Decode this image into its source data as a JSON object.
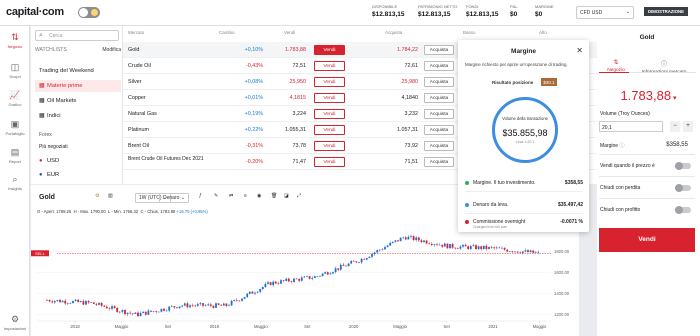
{
  "app": {
    "logo": "capital·com"
  },
  "topbar": {
    "stats": [
      {
        "label": "DISPONIBILE",
        "value": "$12.813,15"
      },
      {
        "label": "PATRIMONIO NETTO",
        "value": "$12.813,15"
      },
      {
        "label": "FONDI",
        "value": "$12.813,15"
      },
      {
        "label": "P&L",
        "value": "$0"
      },
      {
        "label": "MARGINE",
        "value": "$0"
      }
    ],
    "account_select": "CFD USD",
    "mode_badge": "DIMOSTRAZIONE"
  },
  "leftnav": {
    "items": [
      {
        "label": "Negozio",
        "icon": "trade-icon"
      },
      {
        "label": "Scopri",
        "icon": "discover-icon"
      },
      {
        "label": "Grafico",
        "icon": "chart-icon"
      },
      {
        "label": "Portafoglio",
        "icon": "portfolio-icon"
      },
      {
        "label": "Report",
        "icon": "report-icon"
      },
      {
        "label": "Insights",
        "icon": "insights-icon"
      },
      {
        "label": "Impostazioni",
        "icon": "settings-icon"
      }
    ]
  },
  "watchlist": {
    "search_placeholder": "Cerca",
    "tab_label": "WATCHLISTS",
    "edit_label": "Modifica",
    "lists": [
      "Trading del Weekend",
      "Materie prime",
      "Oil Markets",
      "Indici"
    ],
    "forex_label": "Forex",
    "most_traded_label": "Più negoziati",
    "currencies": [
      "USD",
      "EUR"
    ]
  },
  "table": {
    "headers": {
      "market": "Mercato",
      "change": "Cambio",
      "sell": "Vendi",
      "buy": "Acquista",
      "low": "Basso",
      "high": "Alto"
    },
    "sell_label": "Vendi",
    "buy_label": "Acquista",
    "rows": [
      {
        "name": "Gold",
        "change": "+0,10%",
        "sell": "1.783,88",
        "buy": "1.784,22",
        "dir": "pos",
        "sellRed": true,
        "buyRed": true
      },
      {
        "name": "Crude Oil",
        "change": "-0,43%",
        "sell": "72,51",
        "buy": "72,61",
        "dir": "neg",
        "sellRed": false,
        "buyRed": false
      },
      {
        "name": "Silver",
        "change": "+0,08%",
        "sell": "25,950",
        "buy": "25,980",
        "dir": "pos",
        "sellRed": true,
        "buyRed": true
      },
      {
        "name": "Copper",
        "change": "+0,01%",
        "sell": "4,1815",
        "buy": "4,1840",
        "dir": "pos",
        "sellRed": true,
        "buyRed": false
      },
      {
        "name": "Natural Gas",
        "change": "+0,19%",
        "sell": "3,224",
        "buy": "3,232",
        "dir": "pos",
        "sellRed": false,
        "buyRed": false
      },
      {
        "name": "Platinum",
        "change": "+0,22%",
        "sell": "1.055,31",
        "buy": "1.057,31",
        "dir": "pos",
        "sellRed": false,
        "buyRed": false
      },
      {
        "name": "Brent Oil",
        "change": "-0,31%",
        "sell": "73,78",
        "buy": "73,92",
        "dir": "neg",
        "sellRed": false,
        "buyRed": false
      },
      {
        "name": "Brent Crude Oil Futures Dec 2021",
        "change": "-0,20%",
        "sell": "71,47",
        "buy": "71,51",
        "dir": "neg",
        "sellRed": false,
        "buyRed": false
      }
    ]
  },
  "margin_popup": {
    "title": "Margine",
    "description": "Margine richiesto per aprire un'operazione di trading.",
    "result_label": "Risultato posizione",
    "result_value": "$30.1",
    "ring_label": "Volume della transazione",
    "ring_value": "$35.855,98",
    "ring_sub": "Leva 1:20.1",
    "items": [
      {
        "label": "Margine. Il tuo investimento.",
        "value": "$358,55",
        "color": "#2fae63",
        "sub": ""
      },
      {
        "label": "Denaro da leva.",
        "value": "$35.497,42",
        "color": "#3d8de3",
        "sub": ""
      },
      {
        "label": "Commissione overnight",
        "value": "-0.0071 %",
        "color": "#d7232f",
        "sub": "Charged from full size"
      }
    ]
  },
  "chart": {
    "title": "Gold",
    "timeframe": "1W (UTC)",
    "price_type": "Denaro",
    "ohlc": {
      "open": "O - Apert. 1769.25",
      "high": "H - Max. 1790.00",
      "low": "L - Min. 1766.32",
      "close": "C - Chius. 1783.88",
      "change": "+16.70 (+0.95%)"
    },
    "sell_tag": "SELL",
    "y_ticks": [
      "1800.00",
      "1600.00",
      "1400.00",
      "1200.00"
    ],
    "x_ticks": [
      "2018",
      "Maggio",
      "Set",
      "2019",
      "Maggio",
      "Set",
      "2020",
      "Maggio",
      "Set",
      "2021",
      "Maggio"
    ]
  },
  "chart_data": {
    "type": "line",
    "title": "Gold",
    "xlabel": "",
    "ylabel": "",
    "ylim": [
      1150,
      2100
    ],
    "x": [
      "2018-01",
      "2018-05",
      "2018-09",
      "2019-01",
      "2019-05",
      "2019-09",
      "2020-01",
      "2020-05",
      "2020-09",
      "2021-01",
      "2021-05",
      "2021-09"
    ],
    "series": [
      {
        "values": [
          1340,
          1310,
          1200,
          1290,
          1285,
          1500,
          1560,
          1720,
          1940,
          1850,
          1830,
          1784
        ]
      }
    ]
  },
  "right_panel": {
    "title": "Gold",
    "tab_trade": "Negozio",
    "tab_info": "Informazioni mercato",
    "price": "1.783,88",
    "volume_label": "Volume (Troy Ounces)",
    "volume_value": "20,1",
    "margin_label": "Margine",
    "margin_value": "$358,55",
    "toggles": [
      "Vendi quando il prezzo è",
      "Chiudi con perdita",
      "Chiudi con profitto"
    ],
    "sell_button": "Vendi"
  }
}
